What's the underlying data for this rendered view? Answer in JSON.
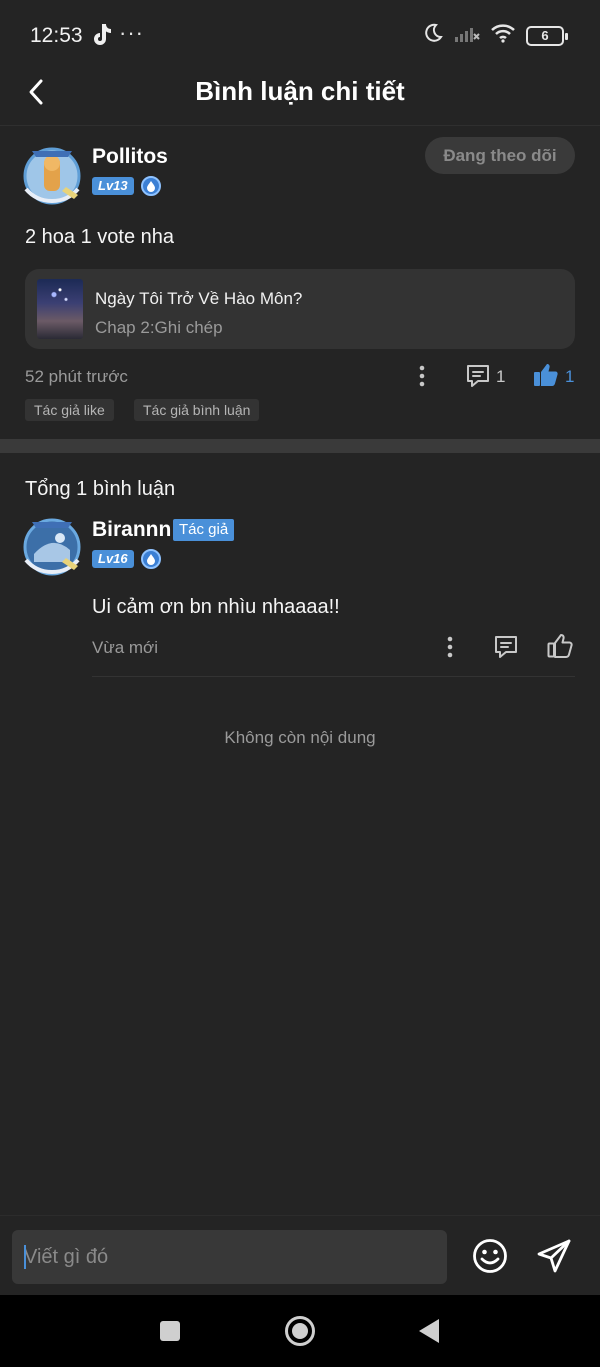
{
  "status_bar": {
    "time": "12:53",
    "dots": "···",
    "battery": "6"
  },
  "header": {
    "title": "Bình luận chi tiết"
  },
  "post": {
    "username": "Pollitos",
    "level": "Lv13",
    "follow_label": "Đang theo dõi",
    "text": "2 hoa 1 vote nha",
    "book": {
      "title": "Ngày Tôi Trở Về Hào Môn?",
      "chapter": "Chap 2:Ghi chép"
    },
    "time": "52 phút trước",
    "comment_count": "1",
    "like_count": "1",
    "tags": [
      "Tác giả like",
      "Tác giả bình luận"
    ]
  },
  "replies": {
    "total_label": "Tổng 1 bình luận",
    "items": [
      {
        "username": "Birannn",
        "author_tag": "Tác giả",
        "level": "Lv16",
        "text": "Ui cảm ơn bn nhìu nhaaaa!!",
        "time": "Vừa mới"
      }
    ],
    "end_label": "Không còn nội dung"
  },
  "input": {
    "placeholder": "Viết gì đó"
  },
  "colors": {
    "background": "#242424",
    "accent_blue": "#4a90d9",
    "muted_text": "#9a9a9a"
  },
  "icons": [
    "tiktok-icon",
    "moon-icon",
    "signal-icon",
    "wifi-icon",
    "battery-icon",
    "back-arrow-icon",
    "drop-badge-icon",
    "more-icon",
    "comment-icon",
    "thumbs-up-icon",
    "emoji-icon",
    "send-icon",
    "square-nav-icon",
    "home-nav-icon",
    "back-nav-icon"
  ]
}
